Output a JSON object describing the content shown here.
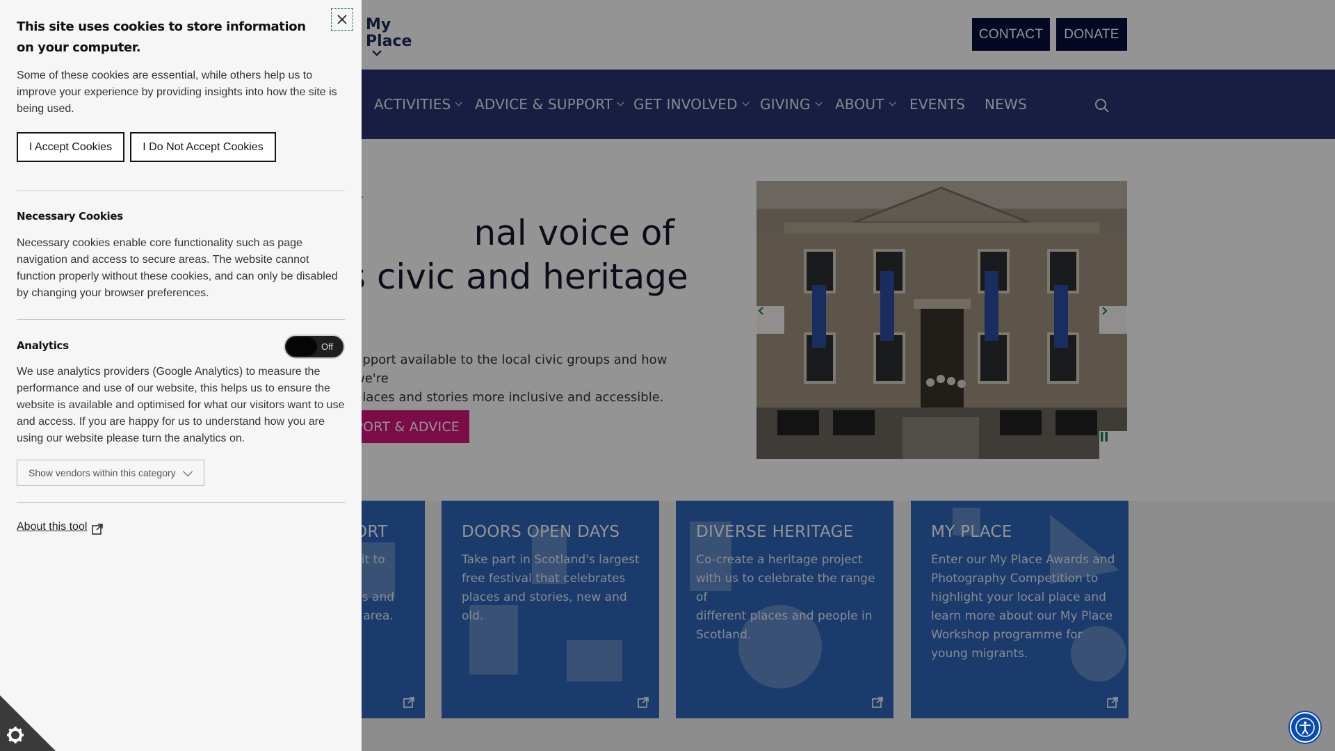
{
  "site": {
    "logo": {
      "line1": "My",
      "line2": "Place"
    },
    "top_buttons": {
      "contact": "CONTACT",
      "donate": "DONATE"
    },
    "nav": [
      {
        "label": "ACTIVITIES",
        "has_dropdown": true
      },
      {
        "label": "ADVICE & SUPPORT",
        "has_dropdown": true
      },
      {
        "label": "GET INVOLVED",
        "has_dropdown": true
      },
      {
        "label": "GIVING",
        "has_dropdown": true
      },
      {
        "label": "ABOUT",
        "has_dropdown": true
      },
      {
        "label": "EVENTS",
        "has_dropdown": false
      },
      {
        "label": "NEWS",
        "has_dropdown": false
      }
    ],
    "hero": {
      "eyebrow": "ST",
      "title_line1": "nal voice of",
      "title_line2": "s civic and heritage",
      "text_line1": "upport available to the local civic groups and how we're",
      "text_line2": "places and stories more inclusive and accessible.",
      "cta": "PPORT & ADVICE"
    },
    "cards": [
      {
        "title": "ORT",
        "lines": [
          "kit to",
          "",
          "gs and",
          "r area."
        ]
      },
      {
        "title": "DOORS OPEN DAYS",
        "lines": [
          "Take part in Scotland's largest",
          "free festival that celebrates",
          "places and stories, new and old."
        ]
      },
      {
        "title": "DIVERSE HERITAGE",
        "lines": [
          "Co-create a heritage project",
          "with us to celebrate the range of",
          "different places and people in",
          "Scotland."
        ]
      },
      {
        "title": "MY PLACE",
        "lines": [
          "Enter our My Place Awards and",
          "Photography Competition to",
          "highlight your local place and",
          "learn more about our My Place",
          "Workshop programme for",
          "young migrants."
        ]
      }
    ]
  },
  "cookie_panel": {
    "title": "This site uses cookies to store information on your computer.",
    "intro": "Some of these cookies are essential, while others help us to improve your experience by providing insights into how the site is being used.",
    "accept_label": "I Accept Cookies",
    "decline_label": "I Do Not Accept Cookies",
    "necessary": {
      "title": "Necessary Cookies",
      "text": "Necessary cookies enable core functionality such as page navigation and access to secure areas. The website cannot function properly without these cookies, and can only be disabled by changing your browser preferences."
    },
    "analytics": {
      "title": "Analytics",
      "toggle_label": "Off",
      "enabled": false,
      "text": "We use analytics providers (Google Analytics) to measure the performance and use of our website, this helps us to ensure the website is available and optimised for what our visitors want to use and access. If you are happy for us to understand how you are using our website please turn the analytics on.",
      "vendors_label": "Show vendors within this category"
    },
    "about_link": "About this tool"
  },
  "colors": {
    "nav_bg": "#2a3470",
    "top_button_bg": "#0a0f3d",
    "cta_pink": "#d6157a",
    "card_blue": "#2e66b8",
    "eyebrow_green": "#1e7a4a",
    "accessibility_blue": "#0b4ab3"
  },
  "icons": {
    "close": "close-icon",
    "search": "search-icon",
    "external": "external-link-icon",
    "cookie": "cookie-gear-icon",
    "accessibility": "accessibility-icon",
    "pause": "pause-icon",
    "prev": "chevron-left-icon",
    "next": "chevron-right-icon"
  }
}
